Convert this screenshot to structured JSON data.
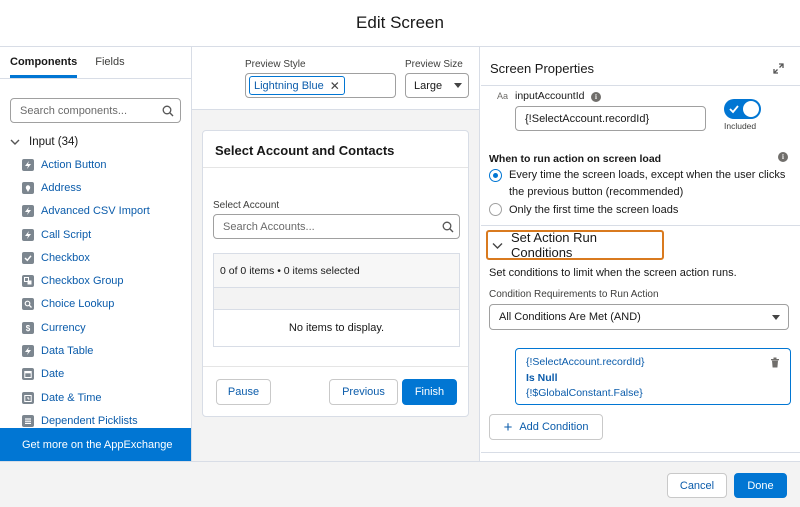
{
  "modal": {
    "title": "Edit Screen"
  },
  "left_panel": {
    "tabs": [
      "Components",
      "Fields"
    ],
    "search_placeholder": "Search components...",
    "category": "Input (34)",
    "items": [
      {
        "label": "Action Button",
        "icon": "lightning-icon"
      },
      {
        "label": "Address",
        "icon": "location-pin-icon"
      },
      {
        "label": "Advanced CSV Import",
        "icon": "lightning-icon"
      },
      {
        "label": "Call Script",
        "icon": "lightning-icon"
      },
      {
        "label": "Checkbox",
        "icon": "checkbox-icon"
      },
      {
        "label": "Checkbox Group",
        "icon": "checkbox-group-icon"
      },
      {
        "label": "Choice Lookup",
        "icon": "lookup-icon"
      },
      {
        "label": "Currency",
        "icon": "currency-icon"
      },
      {
        "label": "Data Table",
        "icon": "lightning-icon"
      },
      {
        "label": "Date",
        "icon": "calendar-icon"
      },
      {
        "label": "Date & Time",
        "icon": "calendar-clock-icon"
      },
      {
        "label": "Dependent Picklists",
        "icon": "picklist-icon"
      }
    ],
    "appexchange": "Get more on the AppExchange"
  },
  "preview": {
    "style_label": "Preview Style",
    "style_value": "Lightning Blue",
    "size_label": "Preview Size",
    "size_value": "Large",
    "card_title": "Select Account and Contacts",
    "select_account_label": "Select Account",
    "select_account_placeholder": "Search Accounts...",
    "items_count": "0 of 0 items • 0 items selected",
    "empty_text": "No items to display.",
    "buttons": {
      "pause": "Pause",
      "previous": "Previous",
      "finish": "Finish"
    }
  },
  "properties": {
    "title": "Screen Properties",
    "variable_type_glyph": "Aa",
    "variable_name": "inputAccountId",
    "variable_value": "{!SelectAccount.recordId}",
    "toggle_on": true,
    "toggle_label": "Included",
    "run_label": "When to run action on screen load",
    "radio_options": [
      "Every time the screen loads, except when the user clicks the previous button (recommended)",
      "Only the first time the screen loads"
    ],
    "selected_radio": 0,
    "section_title": "Set Action Run Conditions",
    "conditions_desc": "Set conditions to limit when the screen action runs.",
    "requirements_label": "Condition Requirements to Run Action",
    "requirements_value": "All Conditions Are Met (AND)",
    "condition": {
      "resource": "{!SelectAccount.recordId}",
      "operator": "Is Null",
      "value": "{!$GlobalConstant.False}"
    },
    "add_condition": "Add Condition"
  },
  "footer": {
    "cancel": "Cancel",
    "done": "Done"
  },
  "colors": {
    "brand": "#0176d3",
    "highlight": "#d97a1f",
    "link": "#0b5cab"
  }
}
